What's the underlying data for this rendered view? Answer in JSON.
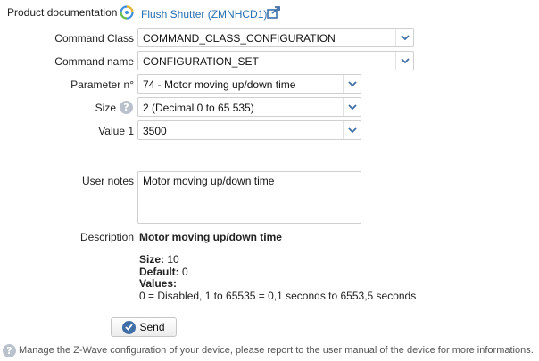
{
  "product": {
    "doc_label": "Product documentation",
    "link_text": "Flush Shutter (ZMNHCD1)",
    "link_icon": "external-link-icon",
    "product_icon": "zwave-logo-icon"
  },
  "form": {
    "command_class": {
      "label": "Command Class",
      "value": "COMMAND_CLASS_CONFIGURATION"
    },
    "command_name": {
      "label": "Command name",
      "value": "CONFIGURATION_SET"
    },
    "parameter": {
      "label": "Parameter n°",
      "value": "74 - Motor moving up/down time"
    },
    "size": {
      "label": "Size",
      "value": "2 (Decimal 0 to 65 535)"
    },
    "value1": {
      "label": "Value 1",
      "value": "3500"
    },
    "user_notes": {
      "label": "User notes",
      "value": "Motor moving up/down time"
    }
  },
  "description": {
    "label": "Description",
    "title": "Motor moving up/down time",
    "size_label": "Size:",
    "size_value": "10",
    "default_label": "Default:",
    "default_value": "0",
    "values_label": "Values:",
    "values_text": "0 = Disabled, 1 to 65535 = 0,1 seconds to 6553,5 seconds"
  },
  "send_label": "Send",
  "footer": {
    "text": "Manage the Z-Wave configuration of your device, please report to the user manual of the device for more informations."
  },
  "colors": {
    "link": "#2a6fb0",
    "arrow": "#3f6fa6",
    "help_icon": "#b9c2cc"
  }
}
